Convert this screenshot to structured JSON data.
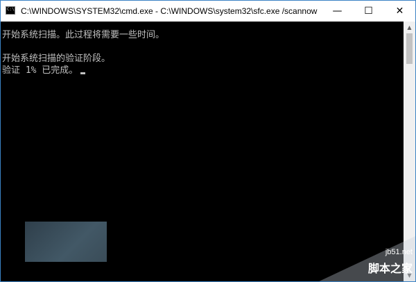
{
  "window": {
    "title": "C:\\WINDOWS\\SYSTEM32\\cmd.exe - C:\\WINDOWS\\system32\\sfc.exe  /scannow",
    "app_icon": "cmd-icon",
    "app_icon_glyph": "C:\\",
    "controls": {
      "minimize": "—",
      "maximize": "☐",
      "close": "✕"
    },
    "frame_color": "#3a82c4"
  },
  "console": {
    "lines": [
      "开始系统扫描。此过程将需要一些时间。",
      "开始系统扫描的验证阶段。",
      "验证 1% 已完成。"
    ],
    "background": "#000000",
    "text_color": "#c0c0c0"
  },
  "scrollbar": {
    "up_arrow": "▲",
    "down_arrow": "▼"
  },
  "watermark": {
    "domain": "jb51.net",
    "brand": "脚本之家"
  }
}
